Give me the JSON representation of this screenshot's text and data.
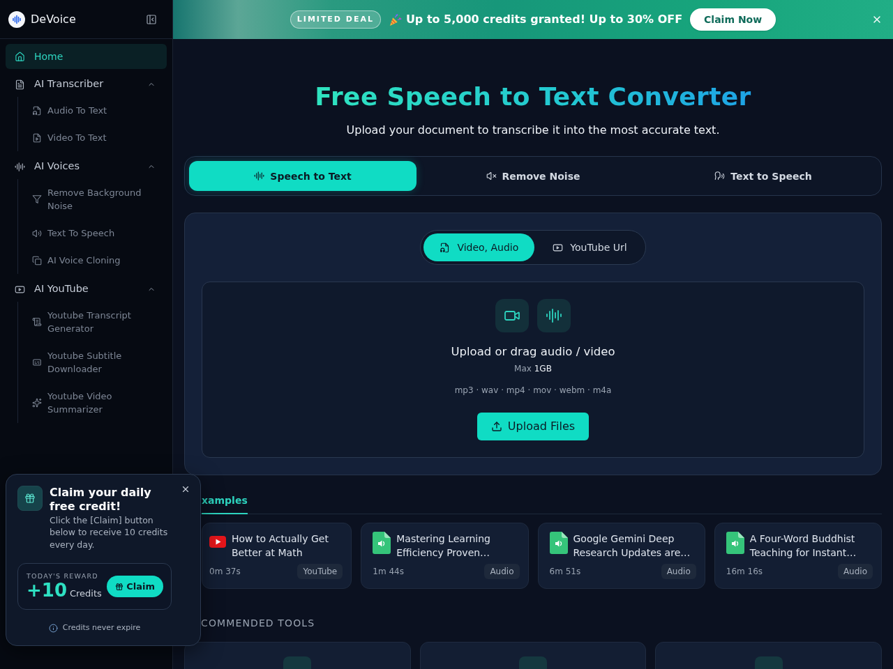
{
  "promo_banner": {
    "badge": "LIMITED DEAL",
    "message": "Up to 5,000 credits granted! Up to 30% OFF",
    "button": "Claim Now"
  },
  "sidebar": {
    "brand": "DeVoice",
    "items": [
      {
        "kind": "link",
        "label": "Home",
        "selected": true
      },
      {
        "kind": "group",
        "label": "AI Transcriber",
        "expanded": true,
        "children": [
          {
            "label": "Audio To Text",
            "selected": false
          },
          {
            "label": "Video To Text",
            "selected": false
          }
        ]
      },
      {
        "kind": "group",
        "label": "AI Voices",
        "expanded": true,
        "children": [
          {
            "label": "Remove Background Noise",
            "selected": false
          },
          {
            "label": "Text To Speech",
            "selected": false
          },
          {
            "label": "AI Voice Cloning",
            "selected": false
          }
        ]
      },
      {
        "kind": "group",
        "label": "AI YouTube",
        "expanded": true,
        "children": [
          {
            "label": "Youtube Transcript Generator",
            "selected": false
          },
          {
            "label": "Youtube Subtitle Downloader",
            "selected": false
          },
          {
            "label": "Youtube Video Summarizer",
            "selected": false
          }
        ]
      }
    ]
  },
  "hero": {
    "title": "Free Speech to Text Converter",
    "subtitle": "Upload your document to transcribe it into the most accurate text."
  },
  "tool_tabs": [
    {
      "label": "Speech to Text",
      "selected": true
    },
    {
      "label": "Remove Noise",
      "selected": false
    },
    {
      "label": "Text to Speech",
      "selected": false
    }
  ],
  "upload": {
    "source_tabs": [
      {
        "label": "Video, Audio",
        "selected": true
      },
      {
        "label": "YouTube Url",
        "selected": false
      }
    ],
    "prompt": "Upload or drag audio / video",
    "max_label": "Max",
    "max_value": "1GB",
    "formats": "mp3 · wav · mp4 · mov · webm · m4a",
    "button": "Upload Files"
  },
  "examples": {
    "tabs": [
      {
        "label": "xamples",
        "selected": true
      }
    ],
    "items": [
      {
        "kind": "youtube",
        "title": "How to Actually Get Better at Math",
        "duration": "0m 37s",
        "tag": "YouTube"
      },
      {
        "kind": "audio",
        "title": "Mastering Learning Efficiency Proven…",
        "duration": "1m 44s",
        "tag": "Audio"
      },
      {
        "kind": "audio",
        "title": "Google Gemini Deep Research Updates are…",
        "duration": "6m 51s",
        "tag": "Audio"
      },
      {
        "kind": "audio",
        "title": "A Four-Word Buddhist Teaching for Instant…",
        "duration": "16m 16s",
        "tag": "Audio"
      }
    ]
  },
  "recommended_tools": {
    "heading": "COMMENDED TOOLS",
    "cards": [
      {
        "kind": "tool"
      },
      {
        "kind": "tool"
      },
      {
        "kind": "tool"
      }
    ]
  },
  "daily_credit_popup": {
    "title": "Claim your daily free credit!",
    "text": "Click the [Claim] button below to receive 10 credits every day.",
    "reward_label": "TODAY'S REWARD",
    "reward_amount": "+10",
    "reward_unit": "Credits",
    "button": "Claim",
    "note": "Credits never expire"
  }
}
